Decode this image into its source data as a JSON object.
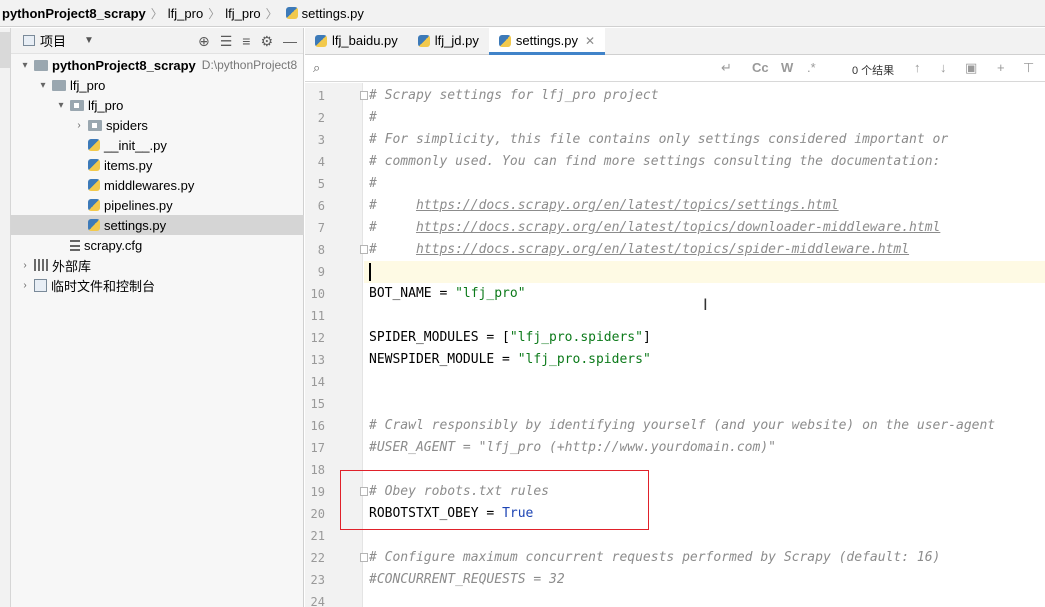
{
  "breadcrumb": {
    "items": [
      "pythonProject8_scrapy",
      "lfj_pro",
      "lfj_pro",
      "settings.py"
    ]
  },
  "project_panel": {
    "title": "项目",
    "tree": [
      {
        "label": "pythonProject8_scrapy",
        "path": "D:\\pythonProject8",
        "type": "root-folder",
        "expanded": true
      },
      {
        "label": "lfj_pro",
        "type": "folder",
        "expanded": true
      },
      {
        "label": "lfj_pro",
        "type": "package",
        "expanded": true
      },
      {
        "label": "spiders",
        "type": "package",
        "expanded": false
      },
      {
        "label": "__init__.py",
        "type": "py"
      },
      {
        "label": "items.py",
        "type": "py"
      },
      {
        "label": "middlewares.py",
        "type": "py"
      },
      {
        "label": "pipelines.py",
        "type": "py"
      },
      {
        "label": "settings.py",
        "type": "py",
        "selected": true
      },
      {
        "label": "scrapy.cfg",
        "type": "cfg"
      },
      {
        "label": "外部库",
        "type": "library",
        "expanded": false
      },
      {
        "label": "临时文件和控制台",
        "type": "scratch",
        "expanded": false
      }
    ]
  },
  "editor": {
    "tabs": [
      {
        "label": "lfj_baidu.py",
        "active": false
      },
      {
        "label": "lfj_jd.py",
        "active": false
      },
      {
        "label": "settings.py",
        "active": true
      }
    ],
    "search": {
      "value": "",
      "result_count": "0 个结果",
      "options": [
        "Cc",
        "W",
        ".*"
      ]
    },
    "lines": [
      {
        "n": "1",
        "tokens": [
          {
            "t": "# Scrapy settings for lfj_pro project",
            "c": "cmt"
          }
        ]
      },
      {
        "n": "2",
        "tokens": [
          {
            "t": "#",
            "c": "cmt"
          }
        ]
      },
      {
        "n": "3",
        "tokens": [
          {
            "t": "# For simplicity, this file contains only settings considered important or",
            "c": "cmt"
          }
        ]
      },
      {
        "n": "4",
        "tokens": [
          {
            "t": "# commonly used. You can find more settings consulting the documentation:",
            "c": "cmt"
          }
        ]
      },
      {
        "n": "5",
        "tokens": [
          {
            "t": "#",
            "c": "cmt"
          }
        ]
      },
      {
        "n": "6",
        "tokens": [
          {
            "t": "#     ",
            "c": "cmt"
          },
          {
            "t": "https://docs.scrapy.org/en/latest/topics/settings.html",
            "c": "cmt-u"
          }
        ]
      },
      {
        "n": "7",
        "tokens": [
          {
            "t": "#     ",
            "c": "cmt"
          },
          {
            "t": "https://docs.scrapy.org/en/latest/topics/downloader-middleware.html",
            "c": "cmt-u"
          }
        ]
      },
      {
        "n": "8",
        "tokens": [
          {
            "t": "#     ",
            "c": "cmt"
          },
          {
            "t": "https://docs.scrapy.org/en/latest/topics/spider-middleware.html",
            "c": "cmt-u"
          }
        ]
      },
      {
        "n": "9",
        "tokens": [],
        "current": true
      },
      {
        "n": "10",
        "tokens": [
          {
            "t": "BOT_NAME = ",
            "c": ""
          },
          {
            "t": "\"lfj_pro\"",
            "c": "str"
          }
        ]
      },
      {
        "n": "11",
        "tokens": []
      },
      {
        "n": "12",
        "tokens": [
          {
            "t": "SPIDER_MODULES = [",
            "c": ""
          },
          {
            "t": "\"lfj_pro.spiders\"",
            "c": "str"
          },
          {
            "t": "]",
            "c": ""
          }
        ]
      },
      {
        "n": "13",
        "tokens": [
          {
            "t": "NEWSPIDER_MODULE = ",
            "c": ""
          },
          {
            "t": "\"lfj_pro.spiders\"",
            "c": "str"
          }
        ]
      },
      {
        "n": "14",
        "tokens": []
      },
      {
        "n": "15",
        "tokens": []
      },
      {
        "n": "16",
        "tokens": [
          {
            "t": "# Crawl responsibly by identifying yourself (and your website) on the user-agent",
            "c": "cmt"
          }
        ]
      },
      {
        "n": "17",
        "tokens": [
          {
            "t": "#USER_AGENT = \"lfj_pro (+http://www.yourdomain.com)\"",
            "c": "cmt"
          }
        ]
      },
      {
        "n": "18",
        "tokens": []
      },
      {
        "n": "19",
        "tokens": [
          {
            "t": "# Obey robots.txt rules",
            "c": "cmt"
          }
        ]
      },
      {
        "n": "20",
        "tokens": [
          {
            "t": "ROBOTSTXT_OBEY = ",
            "c": ""
          },
          {
            "t": "True",
            "c": "kw"
          }
        ]
      },
      {
        "n": "21",
        "tokens": []
      },
      {
        "n": "22",
        "tokens": [
          {
            "t": "# Configure maximum concurrent requests performed by Scrapy (default: 16)",
            "c": "cmt"
          }
        ]
      },
      {
        "n": "23",
        "tokens": [
          {
            "t": "#CONCURRENT_REQUESTS = 32",
            "c": "cmt"
          }
        ]
      },
      {
        "n": "24",
        "tokens": []
      }
    ]
  },
  "colors": {
    "highlight_box": "#e0212a",
    "active_tab_underline": "#4083c9",
    "string": "#0c7a1a",
    "keyword": "#1d44b4",
    "comment": "#8c8c8c"
  }
}
